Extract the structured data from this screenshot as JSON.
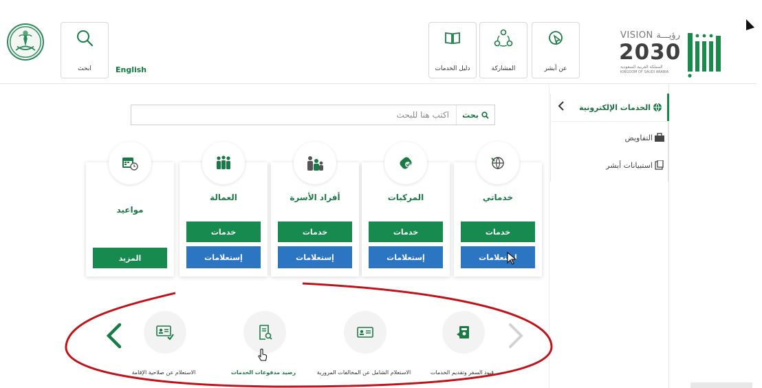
{
  "header": {
    "search_label": "ابحث",
    "language_link": "English",
    "nav": [
      {
        "label": "دليل الخدمات",
        "icon": "book-icon"
      },
      {
        "label": "المشاركة",
        "icon": "share-icon"
      },
      {
        "label": "عن أبشر",
        "icon": "pointer-icon"
      }
    ],
    "vision": {
      "ar_word": "رؤيـــة",
      "en_word": "VISION",
      "year": "2030",
      "sub_ar": "المملكة العربية السعودية",
      "sub_en": "KINGDOM OF SAUDI ARABIA"
    },
    "logo_icon": "absher-logo",
    "emblem_icon": "saudi-emblem"
  },
  "sidebar": {
    "items": [
      {
        "label": "الخدمات الإلكترونية",
        "icon": "globe-icon",
        "active": true
      },
      {
        "label": "التفاويض",
        "icon": "briefcase-icon",
        "active": false
      },
      {
        "label": "استبيانات أبشر",
        "icon": "clipboard-icon",
        "active": false
      }
    ]
  },
  "search": {
    "placeholder": "اكتب هنا للبحث",
    "button_label": "بحث"
  },
  "cards": [
    {
      "title": "خدماتي",
      "icon": "globe-icon",
      "services": "خدمات",
      "inquiries": "استعلامات"
    },
    {
      "title": "المركبات",
      "icon": "car-icon",
      "services": "خدمات",
      "inquiries": "إستعلامات"
    },
    {
      "title": "أفراد الأسرة",
      "icon": "family-icon",
      "services": "خدمات",
      "inquiries": "إستعلامات"
    },
    {
      "title": "العمالة",
      "icon": "workers-icon",
      "services": "خدمات",
      "inquiries": "إستعلامات"
    },
    {
      "title": "مواعيد",
      "icon": "calendar-icon",
      "more": "المزيد"
    }
  ],
  "carousel": {
    "items": [
      {
        "label": "قيود السفر وتقديم الخدمات",
        "icon": "passport-icon"
      },
      {
        "label": "الاستعلام الشامل عن المخالفات المرورية",
        "icon": "id-card-icon"
      },
      {
        "label": "رصيد مدفوعات الخدمات",
        "icon": "receipt-search-icon"
      },
      {
        "label": "الاستعلام عن صلاحية الإقامة",
        "icon": "id-check-icon"
      }
    ]
  },
  "colors": {
    "primary_green": "#168a4f",
    "blue": "#2c75c2",
    "annotation_red": "#c0141c"
  }
}
